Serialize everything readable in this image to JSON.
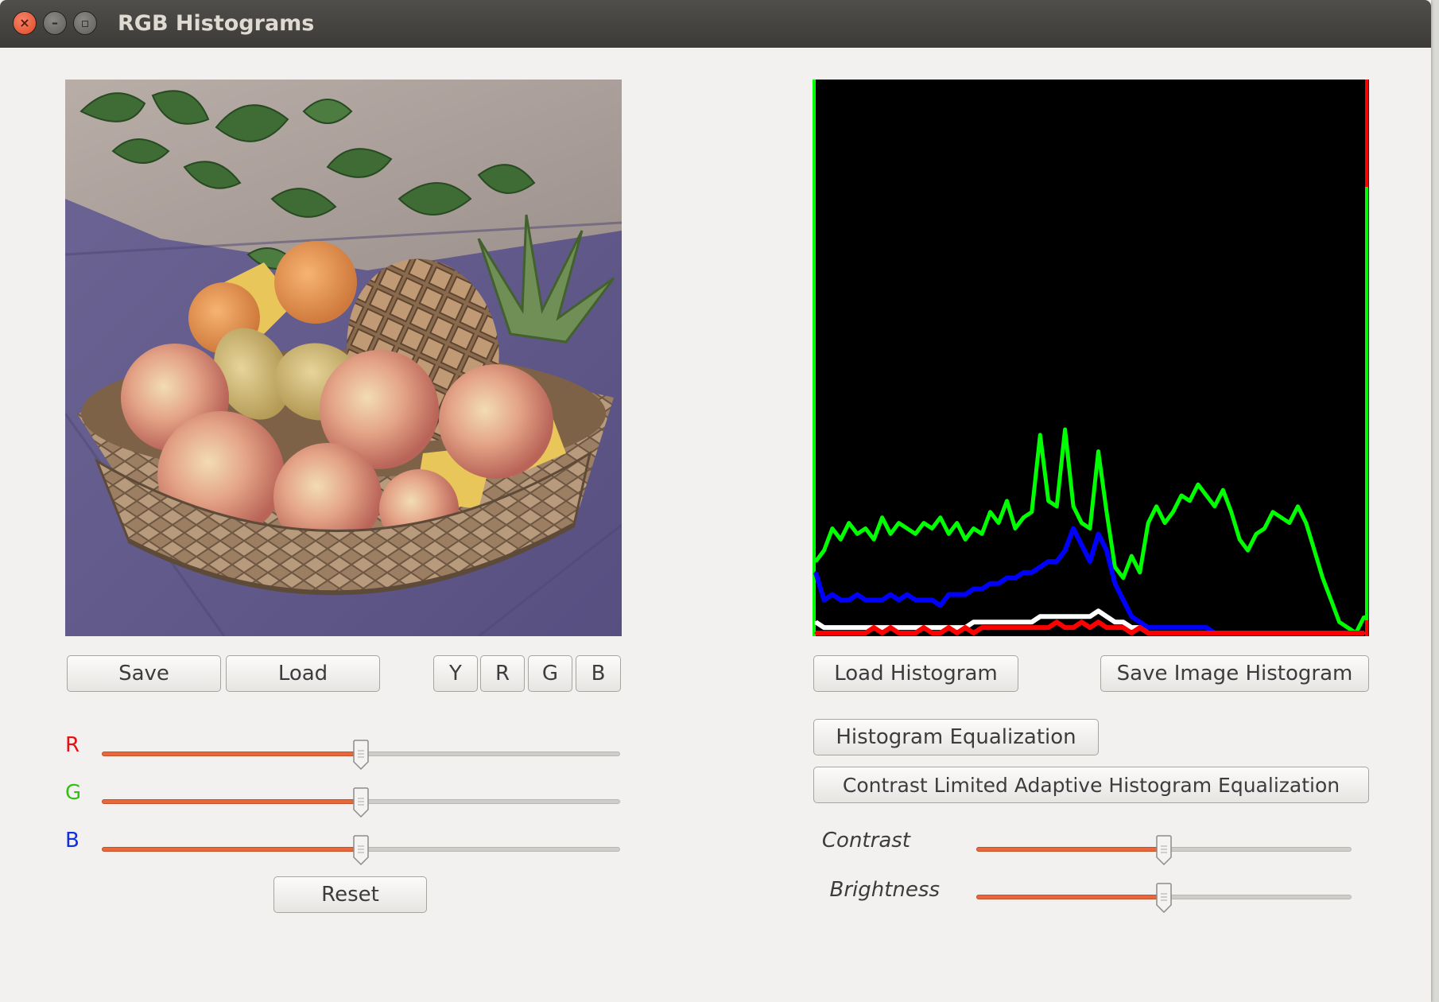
{
  "window": {
    "title": "RGB Histograms"
  },
  "left_panel": {
    "image_alt": "Basket of fruit: apples, pears, oranges and a pineapple on a purple tablecloth",
    "buttons": {
      "save": "Save",
      "load": "Load"
    },
    "channel_buttons": [
      "Y",
      "R",
      "G",
      "B"
    ],
    "sliders": [
      {
        "label": "R",
        "value": 0.5,
        "label_color": "#e81010"
      },
      {
        "label": "G",
        "value": 0.5,
        "label_color": "#30c010"
      },
      {
        "label": "B",
        "value": 0.5,
        "label_color": "#1030e0"
      }
    ],
    "reset": "Reset"
  },
  "right_panel": {
    "buttons": {
      "load_histogram": "Load Histogram",
      "save_image_histogram": "Save Image Histogram",
      "histogram_equalization": "Histogram Equalization",
      "clahe": "Contrast Limited Adaptive Histogram Equalization"
    },
    "sliders": [
      {
        "label": "Contrast",
        "value": 0.5
      },
      {
        "label": "Brightness",
        "value": 0.5
      }
    ]
  },
  "colors": {
    "slider_fill": "#e8673b",
    "window_bg": "#f2f1f0",
    "titlebar": "#3c3b37"
  },
  "chart_data": {
    "type": "line",
    "title": "",
    "xlim": [
      0,
      255
    ],
    "ylim": [
      0,
      1
    ],
    "series": [
      {
        "color": "#00ff00",
        "values": [
          0.13,
          0.15,
          0.19,
          0.17,
          0.2,
          0.18,
          0.19,
          0.17,
          0.21,
          0.18,
          0.2,
          0.19,
          0.18,
          0.2,
          0.19,
          0.21,
          0.18,
          0.2,
          0.17,
          0.19,
          0.18,
          0.22,
          0.2,
          0.24,
          0.19,
          0.21,
          0.22,
          0.36,
          0.24,
          0.23,
          0.37,
          0.23,
          0.2,
          0.19,
          0.33,
          0.22,
          0.12,
          0.1,
          0.14,
          0.11,
          0.2,
          0.23,
          0.2,
          0.22,
          0.25,
          0.24,
          0.27,
          0.25,
          0.23,
          0.26,
          0.22,
          0.17,
          0.15,
          0.18,
          0.19,
          0.22,
          0.21,
          0.2,
          0.23,
          0.2,
          0.15,
          0.1,
          0.06,
          0.02,
          0.01,
          0.0,
          0.03
        ]
      },
      {
        "color": "#0000ff",
        "values": [
          0.11,
          0.06,
          0.07,
          0.06,
          0.06,
          0.07,
          0.06,
          0.06,
          0.06,
          0.07,
          0.06,
          0.07,
          0.06,
          0.06,
          0.06,
          0.05,
          0.07,
          0.07,
          0.07,
          0.08,
          0.08,
          0.09,
          0.09,
          0.1,
          0.1,
          0.11,
          0.11,
          0.12,
          0.13,
          0.13,
          0.15,
          0.19,
          0.16,
          0.13,
          0.18,
          0.15,
          0.09,
          0.06,
          0.03,
          0.02,
          0.01,
          0.01,
          0.01,
          0.01,
          0.01,
          0.01,
          0.01,
          0.01,
          0.0,
          0.0,
          0.0,
          0.0,
          0.0,
          0.0,
          0.0,
          0.0,
          0.0,
          0.0,
          0.0,
          0.0,
          0.0,
          0.0,
          0.0,
          0.0,
          0.0,
          0.0,
          0.0
        ]
      },
      {
        "color": "#ffffff",
        "values": [
          0.02,
          0.01,
          0.01,
          0.01,
          0.01,
          0.01,
          0.01,
          0.01,
          0.01,
          0.01,
          0.01,
          0.01,
          0.01,
          0.01,
          0.01,
          0.01,
          0.01,
          0.01,
          0.01,
          0.02,
          0.02,
          0.02,
          0.02,
          0.02,
          0.02,
          0.02,
          0.02,
          0.03,
          0.03,
          0.03,
          0.03,
          0.03,
          0.03,
          0.03,
          0.04,
          0.03,
          0.02,
          0.02,
          0.01,
          0.01,
          0.0,
          0.0,
          0.0,
          0.0,
          0.0,
          0.0,
          0.0,
          0.0,
          0.0,
          0.0,
          0.0,
          0.0,
          0.0,
          0.0,
          0.0,
          0.0,
          0.0,
          0.0,
          0.0,
          0.0,
          0.0,
          0.0,
          0.0,
          0.0,
          0.0,
          0.0,
          0.0
        ]
      },
      {
        "color": "#ff0000",
        "values": [
          0.0,
          0.0,
          0.0,
          0.0,
          0.0,
          0.0,
          0.0,
          0.01,
          0.0,
          0.01,
          0.0,
          0.0,
          0.0,
          0.01,
          0.0,
          0.0,
          0.01,
          0.0,
          0.01,
          0.0,
          0.01,
          0.01,
          0.01,
          0.01,
          0.01,
          0.01,
          0.01,
          0.01,
          0.01,
          0.02,
          0.01,
          0.01,
          0.02,
          0.01,
          0.02,
          0.01,
          0.01,
          0.01,
          0.0,
          0.01,
          0.0,
          0.0,
          0.0,
          0.0,
          0.0,
          0.0,
          0.0,
          0.0,
          0.0,
          0.0,
          0.0,
          0.0,
          0.0,
          0.0,
          0.0,
          0.0,
          0.0,
          0.0,
          0.0,
          0.0,
          0.0,
          0.0,
          0.0,
          0.0,
          0.0,
          0.0,
          0.0
        ]
      }
    ]
  }
}
